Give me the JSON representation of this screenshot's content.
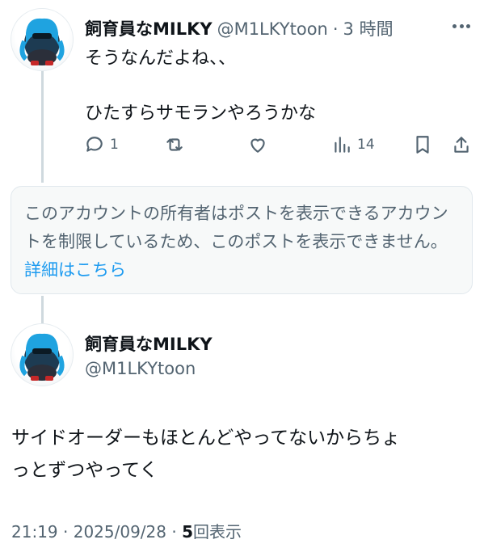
{
  "reply": {
    "display_name": "飼育員なMILKY",
    "handle": "@M1LKYtoon",
    "separator": "·",
    "time": "3 時間",
    "text_line1": "そうなんだよね、、",
    "text_line2": "ひたすらサモランやろうかな",
    "actions": {
      "reply_count": "1",
      "repost_count": "",
      "like_count": "",
      "views_count": "14"
    }
  },
  "notice": {
    "text": "このアカウントの所有者はポストを表示できるアカウントを制限しているため、このポストを表示できません。",
    "link": "詳細はこちら"
  },
  "main_post": {
    "display_name": "飼育員なMILKY",
    "handle": "@M1LKYtoon",
    "text_line1": "サイドオーダーもほとんどやってないからちょ",
    "text_line2": "っとずつやってく",
    "time": "21:19",
    "date": "2025/09/28",
    "views_count": "5",
    "views_label": "回表示"
  },
  "colors": {
    "text": "#0f1419",
    "secondary": "#536471",
    "link": "#1d9bf0",
    "notice_bg": "#f7f9f9"
  }
}
